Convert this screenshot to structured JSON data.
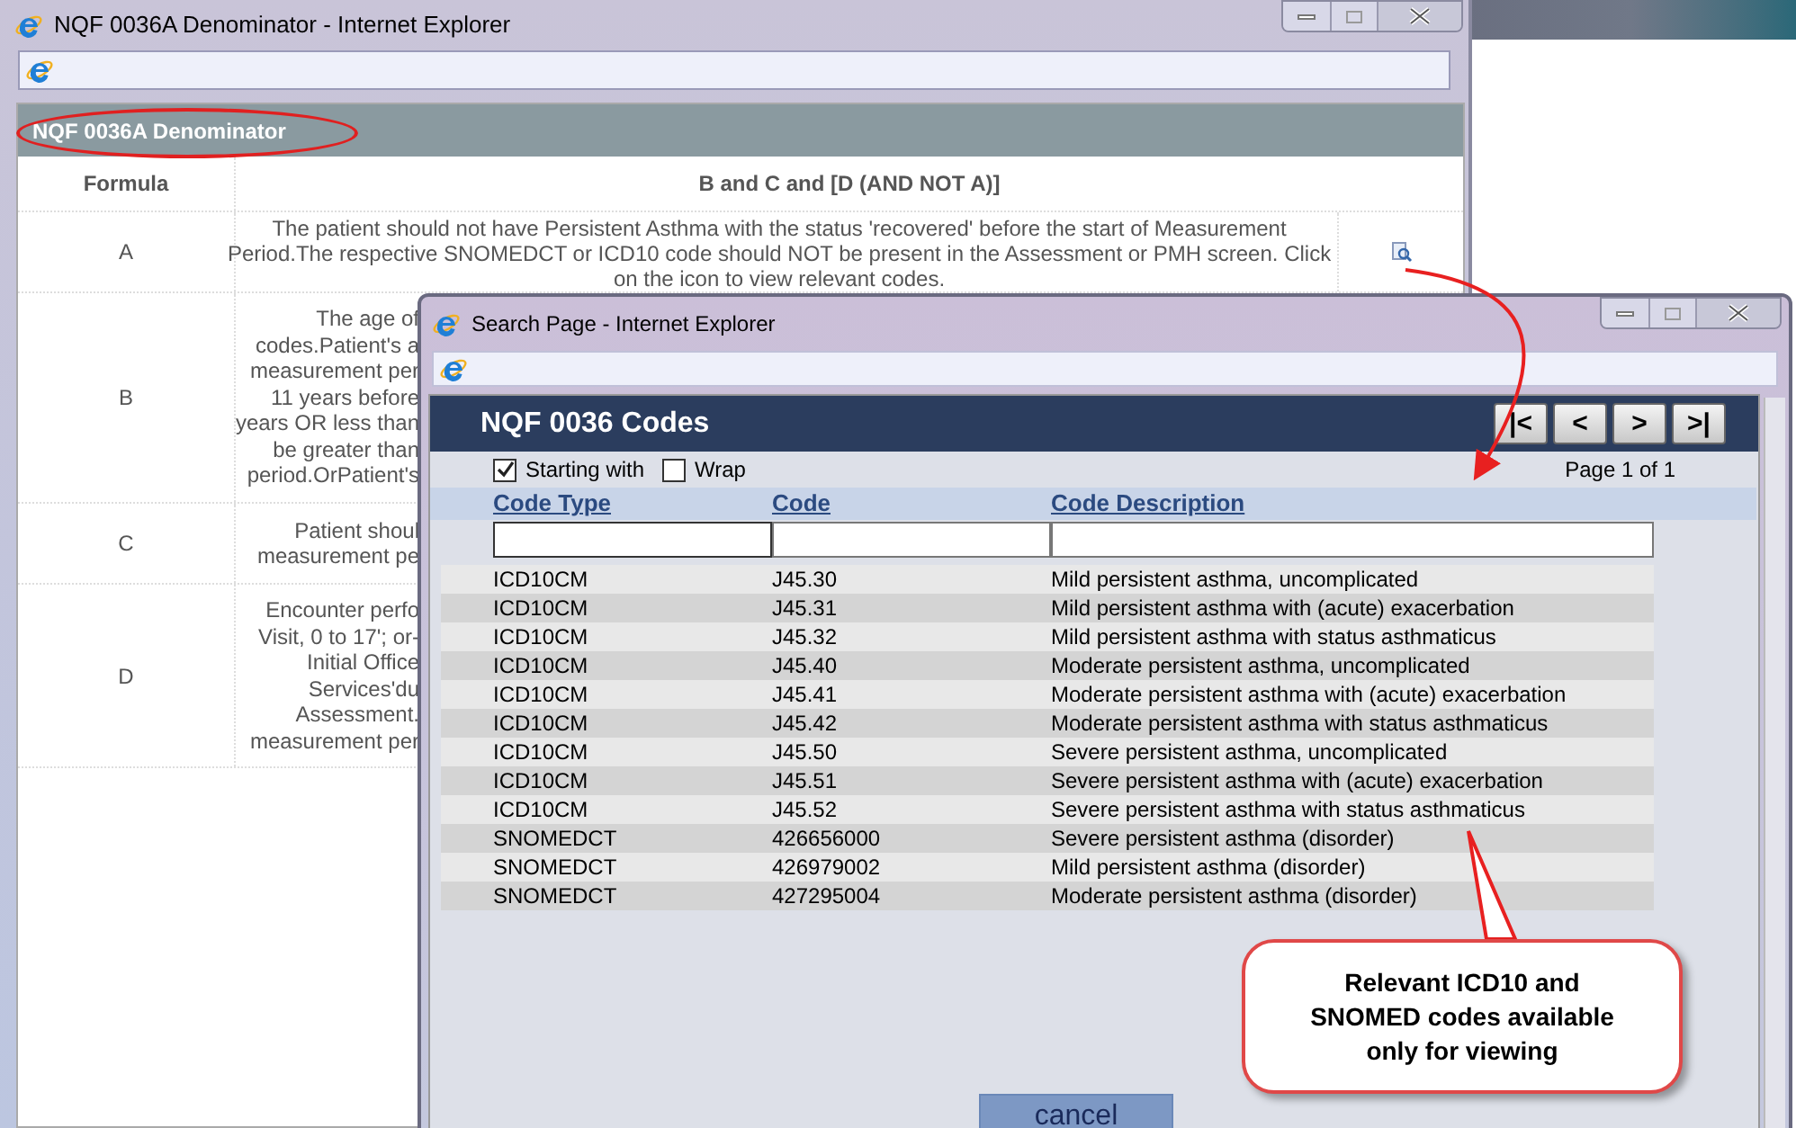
{
  "main_window": {
    "title": "NQF 0036A Denominator - Internet Explorer",
    "panel_title": "NQF 0036A Denominator",
    "columns": [
      "Formula",
      "B and C and [D (AND NOT A)]"
    ],
    "rows": [
      {
        "formula": "A",
        "lines": [
          "The patient should not have Persistent Asthma with the status 'recovered' before the start of Measurement",
          "Period.The respective SNOMEDCT or ICD10 code should NOT be present in the Assessment or PMH screen. Click",
          "on the icon to view relevant codes."
        ]
      },
      {
        "formula": "B",
        "lines": [
          "The age of",
          "codes.Patient's a",
          "measurement per",
          "11 years before",
          "years OR less than",
          "be greater than",
          "period.OrPatient's"
        ]
      },
      {
        "formula": "C",
        "lines": [
          "Patient shoul",
          "measurement pe"
        ]
      },
      {
        "formula": "D",
        "lines": [
          "Encounter perfo",
          "Visit, 0 to 17'; or-",
          "Initial Office",
          "Services'du",
          "Assessment.",
          "measurement per"
        ]
      }
    ]
  },
  "search_window": {
    "title": "Search Page - Internet Explorer",
    "heading": "NQF 0036 Codes",
    "nav_buttons": [
      "|<",
      "<",
      ">",
      ">|"
    ],
    "options": [
      {
        "label": "Starting with",
        "checked": true
      },
      {
        "label": "Wrap",
        "checked": false
      }
    ],
    "page_info": "Page 1 of 1",
    "columns": [
      "Code Type",
      "Code",
      "Code Description"
    ],
    "rows": [
      {
        "code_type": "ICD10CM",
        "code": "J45.30",
        "description": "Mild persistent asthma, uncomplicated"
      },
      {
        "code_type": "ICD10CM",
        "code": "J45.31",
        "description": "Mild persistent asthma with (acute) exacerbation"
      },
      {
        "code_type": "ICD10CM",
        "code": "J45.32",
        "description": "Mild persistent asthma with status asthmaticus"
      },
      {
        "code_type": "ICD10CM",
        "code": "J45.40",
        "description": "Moderate persistent asthma, uncomplicated"
      },
      {
        "code_type": "ICD10CM",
        "code": "J45.41",
        "description": "Moderate persistent asthma with (acute) exacerbation"
      },
      {
        "code_type": "ICD10CM",
        "code": "J45.42",
        "description": "Moderate persistent asthma with status asthmaticus"
      },
      {
        "code_type": "ICD10CM",
        "code": "J45.50",
        "description": "Severe persistent asthma, uncomplicated"
      },
      {
        "code_type": "ICD10CM",
        "code": "J45.51",
        "description": "Severe persistent asthma with (acute) exacerbation"
      },
      {
        "code_type": "ICD10CM",
        "code": "J45.52",
        "description": "Severe persistent asthma with status asthmaticus"
      },
      {
        "code_type": "SNOMEDCT",
        "code": "426656000",
        "description": "Severe persistent asthma (disorder)"
      },
      {
        "code_type": "SNOMEDCT",
        "code": "426979002",
        "description": "Mild persistent asthma (disorder)"
      },
      {
        "code_type": "SNOMEDCT",
        "code": "427295004",
        "description": "Moderate persistent asthma (disorder)"
      }
    ],
    "cancel": "cancel"
  },
  "callout": {
    "text": "Relevant ICD10 and SNOMED codes available only for viewing"
  }
}
